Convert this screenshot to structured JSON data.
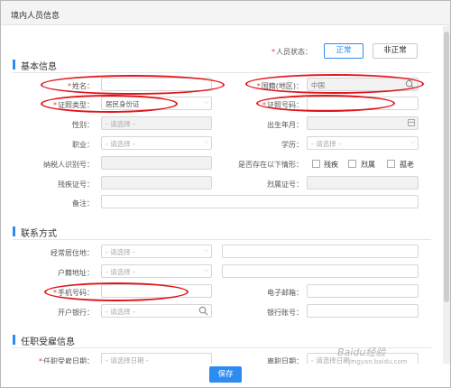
{
  "dialog": {
    "title": "境内人员信息"
  },
  "status": {
    "label": "人员状态：",
    "options": [
      "正常",
      "非正常"
    ],
    "selected": "正常"
  },
  "sections": {
    "basic": "基本信息",
    "contact": "联系方式",
    "employment": "任职受雇信息"
  },
  "basic": {
    "name_label": "姓名：",
    "nationality_label": "国籍(地区)：",
    "nationality_value": "中国",
    "id_type_label": "证照类型：",
    "id_type_value": "居民身份证",
    "id_number_label": "证照号码：",
    "gender_label": "性别：",
    "gender_placeholder": "- 请选择 -",
    "birthdate_label": "出生年月：",
    "occupation_label": "职业：",
    "occupation_placeholder": "- 请选择 -",
    "education_label": "学历：",
    "education_placeholder": "- 请选择 -",
    "taxpayer_id_label": "纳税人识别号：",
    "special_label": "是否存在以下情形：",
    "special_options": [
      "残疾",
      "烈属",
      "孤老"
    ],
    "disability_cert_label": "残疾证号：",
    "martyr_cert_label": "烈属证号：",
    "remark_label": "备注："
  },
  "contact": {
    "residence_label": "经常居住地：",
    "residence_placeholder": "- 请选择 -",
    "household_label": "户籍地址：",
    "household_placeholder": "- 请选择 -",
    "phone_label": "手机号码：",
    "email_label": "电子邮箱：",
    "bank_label": "开户银行：",
    "bank_placeholder": "- 请选择 -",
    "account_label": "银行账号："
  },
  "employment": {
    "hire_date_label": "任职受雇日期：",
    "hire_date_placeholder": "- 请选择日期 -",
    "leave_date_label": "离职日期：",
    "leave_date_placeholder": "- 请选择日期 -"
  },
  "footer": {
    "save_label": "保存"
  },
  "watermark": {
    "text": "Baidu经验",
    "sub": "jingyan.baidu.com"
  },
  "colors": {
    "accent": "#2d8cf0",
    "required": "#e4393c",
    "annotation": "#e1141a"
  }
}
